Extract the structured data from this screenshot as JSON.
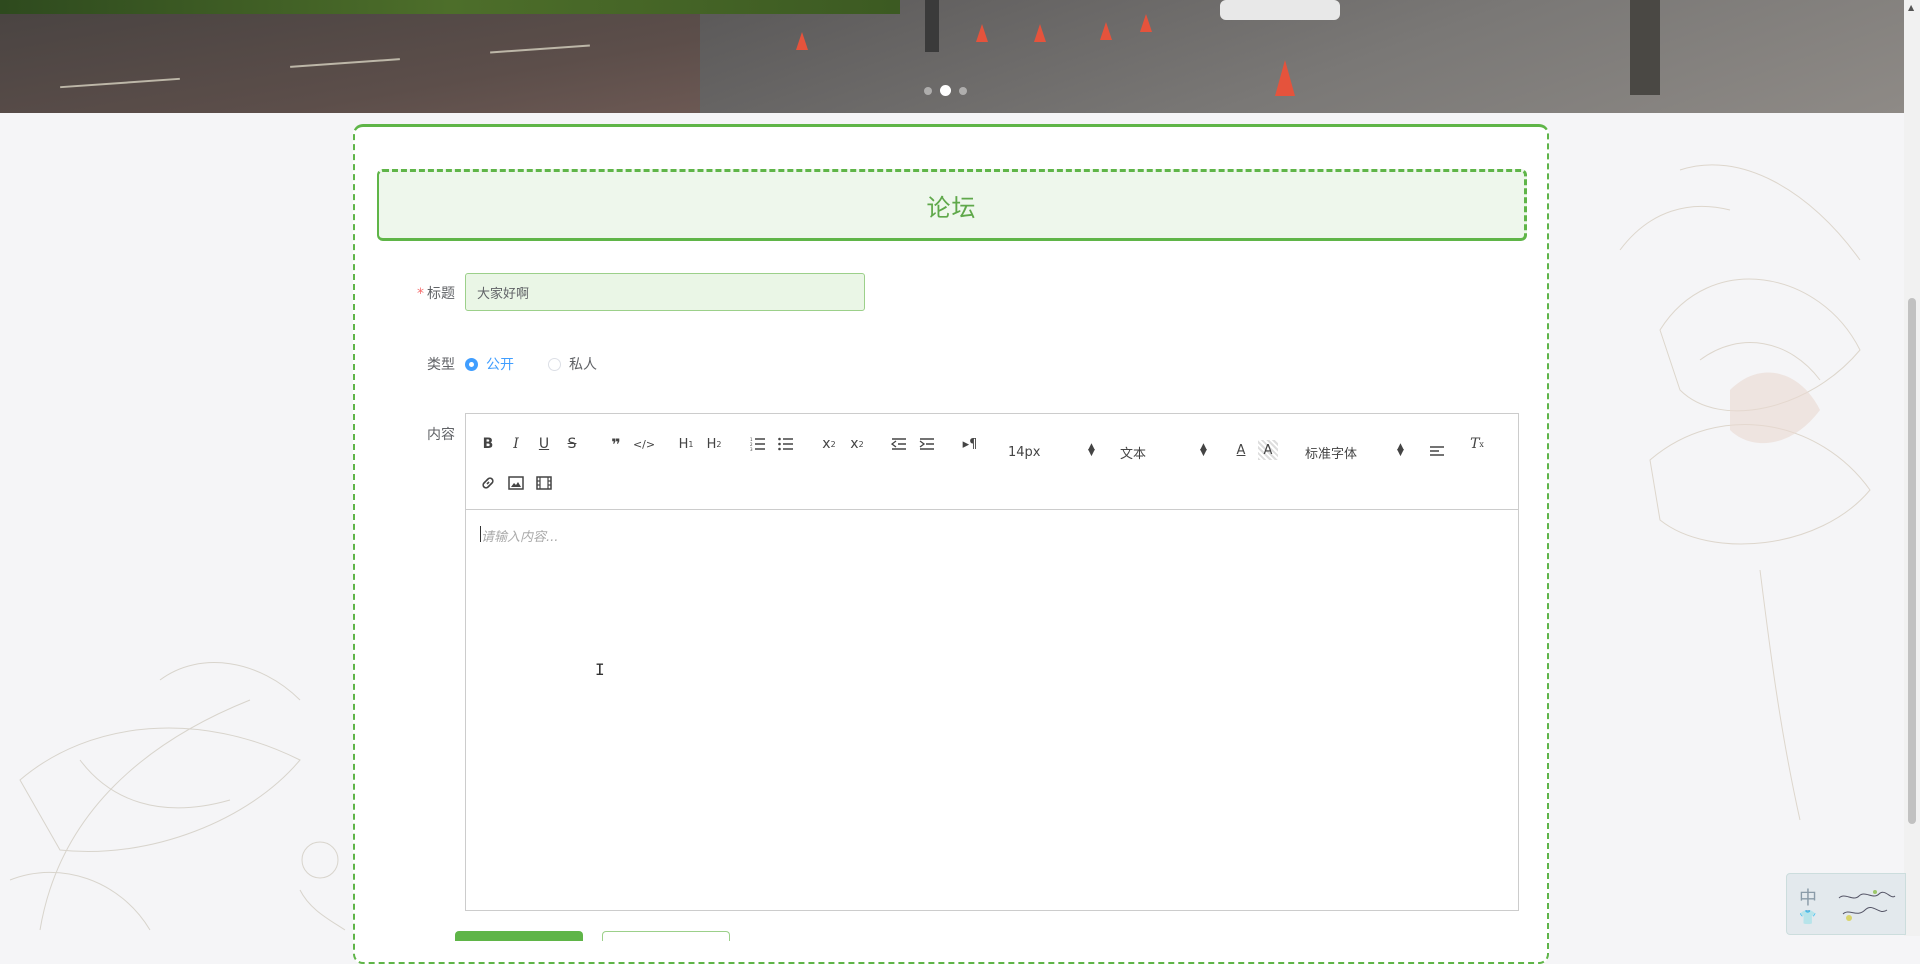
{
  "carousel": {
    "slide_count": 3,
    "active_index": 1
  },
  "panel": {
    "title": "论坛"
  },
  "form": {
    "title_label": "标题",
    "title_required": "*",
    "title_value": "大家好啊",
    "type_label": "类型",
    "type_options": [
      {
        "label": "公开",
        "checked": true
      },
      {
        "label": "私人",
        "checked": false
      }
    ],
    "content_label": "内容"
  },
  "editor": {
    "placeholder": "请输入内容...",
    "toolbar": {
      "font_size": "14px",
      "header_picker": "文本",
      "font_family": "标准字体"
    }
  },
  "ime": {
    "mode": "中"
  },
  "colors": {
    "accent": "#5fb548",
    "header_bg": "#eef7ec",
    "radio_active": "#409eff",
    "required": "#f56c6c"
  }
}
